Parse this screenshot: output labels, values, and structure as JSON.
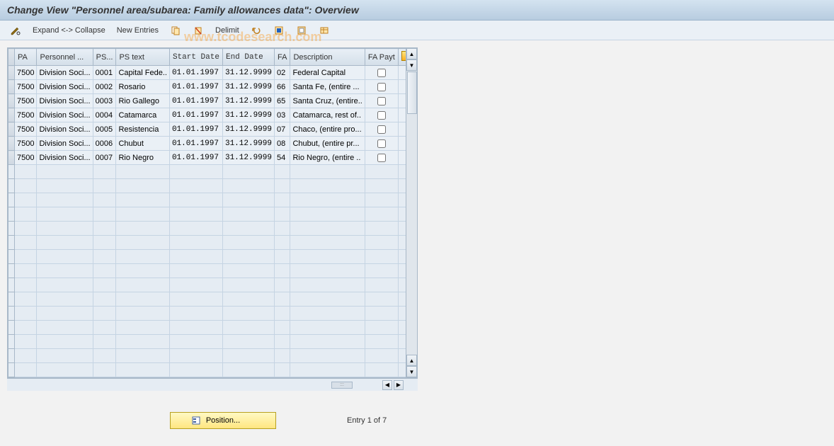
{
  "title": "Change View \"Personnel area/subarea: Family allowances data\": Overview",
  "toolbar": {
    "expand_collapse": "Expand <-> Collapse",
    "new_entries": "New Entries",
    "delimit": "Delimit"
  },
  "watermark": "www.tcodesearch.com",
  "columns": {
    "pa": "PA",
    "personnel": "Personnel ...",
    "ps": "PS...",
    "pstext": "PS text",
    "start": "Start Date",
    "end": "End Date",
    "fa": "FA",
    "desc": "Description",
    "payt": "FA Payt"
  },
  "rows": [
    {
      "pa": "7500",
      "personnel": "Division Soci...",
      "ps": "0001",
      "pstext": "Capital Fede..",
      "start": "01.01.1997",
      "end": "31.12.9999",
      "fa": "02",
      "desc": "Federal Capital",
      "payt": false
    },
    {
      "pa": "7500",
      "personnel": "Division Soci...",
      "ps": "0002",
      "pstext": "Rosario",
      "start": "01.01.1997",
      "end": "31.12.9999",
      "fa": "66",
      "desc": "Santa Fe, (entire ...",
      "payt": false
    },
    {
      "pa": "7500",
      "personnel": "Division Soci...",
      "ps": "0003",
      "pstext": "Rio Gallego",
      "start": "01.01.1997",
      "end": "31.12.9999",
      "fa": "65",
      "desc": "Santa Cruz, (entire..",
      "payt": false
    },
    {
      "pa": "7500",
      "personnel": "Division Soci...",
      "ps": "0004",
      "pstext": "Catamarca",
      "start": "01.01.1997",
      "end": "31.12.9999",
      "fa": "03",
      "desc": "Catamarca, rest of..",
      "payt": false
    },
    {
      "pa": "7500",
      "personnel": "Division Soci...",
      "ps": "0005",
      "pstext": "Resistencia",
      "start": "01.01.1997",
      "end": "31.12.9999",
      "fa": "07",
      "desc": "Chaco, (entire pro...",
      "payt": false
    },
    {
      "pa": "7500",
      "personnel": "Division Soci...",
      "ps": "0006",
      "pstext": "Chubut",
      "start": "01.01.1997",
      "end": "31.12.9999",
      "fa": "08",
      "desc": "Chubut, (entire pr...",
      "payt": false
    },
    {
      "pa": "7500",
      "personnel": "Division Soci...",
      "ps": "0007",
      "pstext": "Rio Negro",
      "start": "01.01.1997",
      "end": "31.12.9999",
      "fa": "54",
      "desc": "Rio Negro, (entire ..",
      "payt": false
    }
  ],
  "empty_rows": 15,
  "footer": {
    "position": "Position...",
    "entry": "Entry 1 of 7"
  }
}
